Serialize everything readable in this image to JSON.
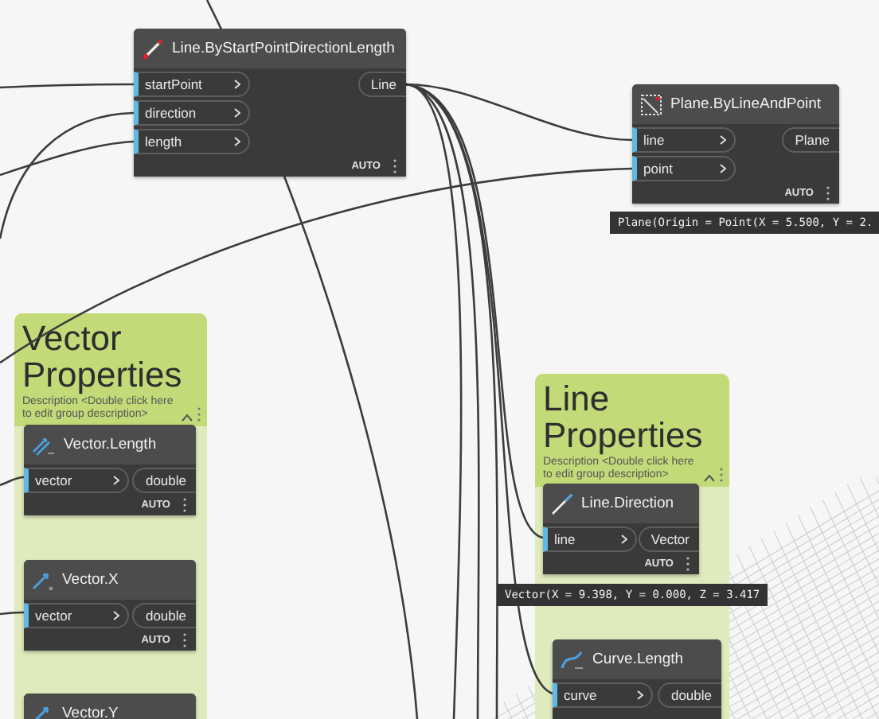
{
  "nodes": [
    {
      "title": "Line.ByStartPointDirectionLength",
      "inputs": [
        "startPoint",
        "direction",
        "length"
      ],
      "outputs": [
        "Line"
      ],
      "run_mode": "AUTO"
    },
    {
      "title": "Plane.ByLineAndPoint",
      "inputs": [
        "line",
        "point"
      ],
      "outputs": [
        "Plane"
      ],
      "run_mode": "AUTO",
      "preview": "Plane(Origin = Point(X = 5.500, Y = 2."
    }
  ],
  "groups": [
    {
      "title": "Vector Properties",
      "description": "Description <Double click here to edit group description>",
      "nodes": [
        {
          "title": "Vector.Length",
          "inputs": [
            "vector"
          ],
          "outputs": [
            "double"
          ],
          "run_mode": "AUTO"
        },
        {
          "title": "Vector.X",
          "inputs": [
            "vector"
          ],
          "outputs": [
            "double"
          ],
          "run_mode": "AUTO"
        },
        {
          "title": "Vector.Y"
        }
      ]
    },
    {
      "title": "Line Properties",
      "description": "Description <Double click here to edit group description>",
      "nodes": [
        {
          "title": "Line.Direction",
          "inputs": [
            "line"
          ],
          "outputs": [
            "Vector"
          ],
          "run_mode": "AUTO",
          "preview": "Vector(X = 9.398, Y = 0.000, Z = 3.417"
        },
        {
          "title": "Curve.Length",
          "inputs": [
            "curve"
          ],
          "outputs": [
            "double"
          ]
        }
      ]
    }
  ]
}
